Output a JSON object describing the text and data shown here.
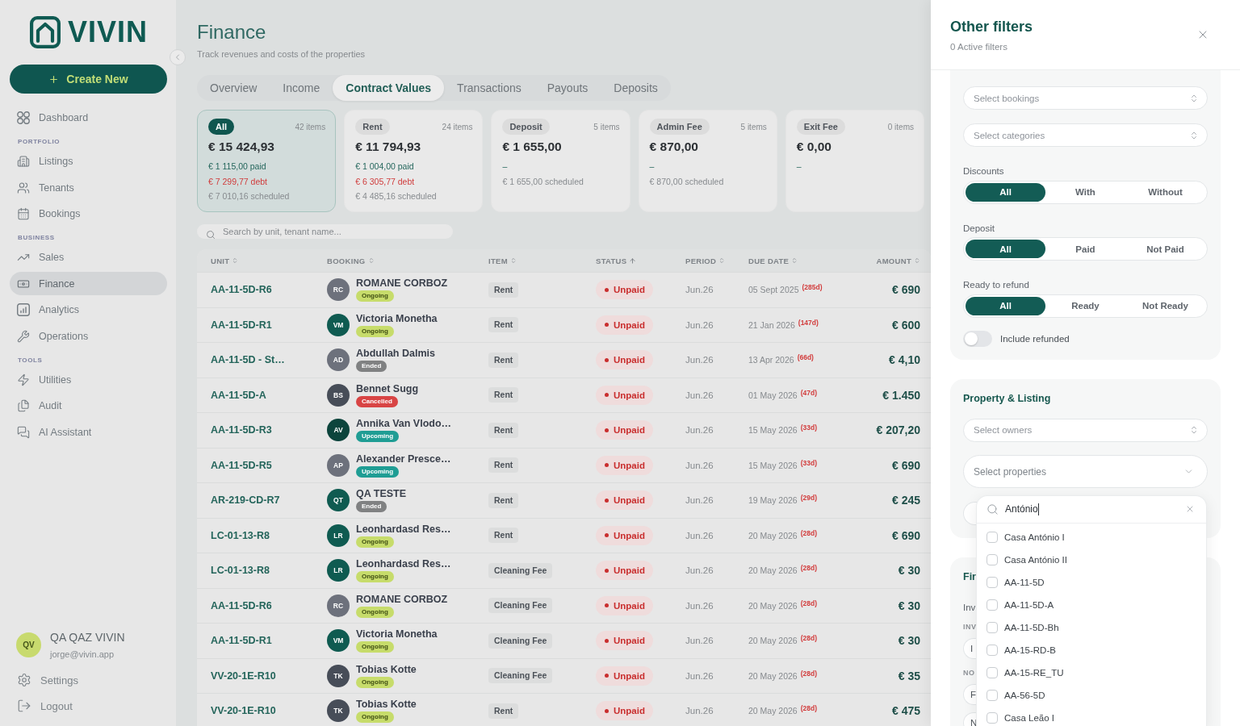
{
  "sidebar": {
    "logo": "VIVIN",
    "create_button": "Create New",
    "nav": [
      {
        "items": [
          {
            "label": "Dashboard",
            "selected": false
          }
        ]
      },
      {
        "heading": "PORTFOLIO",
        "items": [
          {
            "label": "Listings",
            "selected": false
          },
          {
            "label": "Tenants",
            "selected": false
          },
          {
            "label": "Bookings",
            "selected": false
          }
        ]
      },
      {
        "heading": "BUSINESS",
        "items": [
          {
            "label": "Sales",
            "selected": false
          },
          {
            "label": "Finance",
            "selected": true
          },
          {
            "label": "Analytics",
            "selected": false
          },
          {
            "label": "Operations",
            "selected": false
          }
        ]
      },
      {
        "heading": "TOOLS",
        "items": [
          {
            "label": "Utilities",
            "selected": false
          },
          {
            "label": "Audit",
            "selected": false
          },
          {
            "label": "AI Assistant",
            "selected": false
          }
        ]
      }
    ],
    "user": {
      "initials": "QV",
      "name": "QA QAZ VIVIN",
      "email": "jorge@vivin.app"
    },
    "footer_links": [
      "Settings",
      "Logout"
    ]
  },
  "page": {
    "title": "Finance",
    "subtitle": "Track revenues and costs of the properties"
  },
  "tabs": [
    {
      "label": "Overview",
      "selected": false
    },
    {
      "label": "Income",
      "selected": false
    },
    {
      "label": "Contract Values",
      "selected": true
    },
    {
      "label": "Transactions",
      "selected": false
    },
    {
      "label": "Payouts",
      "selected": false
    },
    {
      "label": "Deposits",
      "selected": false
    }
  ],
  "summary_cards": [
    {
      "label": "All",
      "count": "42 items",
      "total": "€ 15 424,93",
      "selected": true,
      "lines": [
        {
          "text": "€ 1 115,00 paid",
          "kind": "paid"
        },
        {
          "text": "€ 7 299,77 debt",
          "kind": "debt"
        },
        {
          "text": "€ 7 010,16 scheduled",
          "kind": "scheduled"
        }
      ]
    },
    {
      "label": "Rent",
      "count": "24 items",
      "total": "€ 11 794,93",
      "selected": false,
      "lines": [
        {
          "text": "€ 1 004,00 paid",
          "kind": "paid"
        },
        {
          "text": "€ 6 305,77 debt",
          "kind": "debt"
        },
        {
          "text": "€ 4 485,16 scheduled",
          "kind": "scheduled"
        }
      ]
    },
    {
      "label": "Deposit",
      "count": "5 items",
      "total": "€ 1 655,00",
      "selected": false,
      "lines": [
        {
          "text": "–",
          "kind": "paid"
        },
        {
          "text": "€ 1 655,00 scheduled",
          "kind": "scheduled"
        }
      ]
    },
    {
      "label": "Admin Fee",
      "count": "5 items",
      "total": "€ 870,00",
      "selected": false,
      "lines": [
        {
          "text": "–",
          "kind": "paid"
        },
        {
          "text": "€ 870,00 scheduled",
          "kind": "scheduled"
        }
      ]
    },
    {
      "label": "Exit Fee",
      "count": "0 items",
      "total": "€ 0,00",
      "selected": false,
      "lines": [
        {
          "text": "–",
          "kind": "paid"
        }
      ]
    }
  ],
  "search": {
    "placeholder": "Search by unit, tenant name..."
  },
  "table": {
    "columns": [
      {
        "label": "UNIT",
        "sorted": false
      },
      {
        "label": "BOOKING",
        "sorted": false
      },
      {
        "label": "ITEM",
        "sorted": false
      },
      {
        "label": "STATUS",
        "sorted": true
      },
      {
        "label": "PERIOD",
        "sorted": false
      },
      {
        "label": "DUE DATE",
        "sorted": false
      },
      {
        "label": "AMOUNT",
        "sorted": false
      }
    ],
    "rows": [
      {
        "unit": "AA-11-5D-R6",
        "booking": {
          "initials": "RC",
          "name": "ROMANE CORBOZ",
          "color": "#6d717c",
          "stage": {
            "label": "Ongoing",
            "kind": "ongoing"
          }
        },
        "item": "Rent",
        "status": {
          "label": "Unpaid",
          "kind": "unpaid"
        },
        "period": "Jun.26",
        "due_date": "05 Sept 2025",
        "overdue": "(285d)",
        "amount": "€ 690"
      },
      {
        "unit": "AA-11-5D-R1",
        "booking": {
          "initials": "VM",
          "name": "Victoria Monetha",
          "color": "#0f5b51",
          "stage": {
            "label": "Ongoing",
            "kind": "ongoing"
          }
        },
        "item": "Rent",
        "status": {
          "label": "Unpaid",
          "kind": "unpaid"
        },
        "period": "Jun.26",
        "due_date": "21 Jan 2026",
        "overdue": "(147d)",
        "amount": "€ 600"
      },
      {
        "unit": "AA-11-5D - St…",
        "booking": {
          "initials": "AD",
          "name": "Abdullah Dalmis",
          "color": "#6d717c",
          "stage": {
            "label": "Ended",
            "kind": "ended"
          }
        },
        "item": "Rent",
        "status": {
          "label": "Unpaid",
          "kind": "unpaid"
        },
        "period": "Jun.26",
        "due_date": "13 Apr 2026",
        "overdue": "(66d)",
        "amount": "€ 4,10"
      },
      {
        "unit": "AA-11-5D-A",
        "booking": {
          "initials": "BS",
          "name": "Bennet Sugg",
          "color": "#474d58",
          "stage": {
            "label": "Cancelled",
            "kind": "cancelled"
          }
        },
        "item": "Rent",
        "status": {
          "label": "Unpaid",
          "kind": "unpaid"
        },
        "period": "Jun.26",
        "due_date": "01 May 2026",
        "overdue": "(47d)",
        "amount": "€ 1.450"
      },
      {
        "unit": "AA-11-5D-R3",
        "booking": {
          "initials": "AV",
          "name": "Annika Van Vlodo…",
          "color": "#0c443c",
          "stage": {
            "label": "Upcoming",
            "kind": "upcoming"
          }
        },
        "item": "Rent",
        "status": {
          "label": "Unpaid",
          "kind": "unpaid"
        },
        "period": "Jun.26",
        "due_date": "15 May 2026",
        "overdue": "(33d)",
        "amount": "€ 207,20"
      },
      {
        "unit": "AA-11-5D-R5",
        "booking": {
          "initials": "AP",
          "name": "Alexander Presce…",
          "color": "#6d717c",
          "stage": {
            "label": "Upcoming",
            "kind": "upcoming"
          }
        },
        "item": "Rent",
        "status": {
          "label": "Unpaid",
          "kind": "unpaid"
        },
        "period": "Jun.26",
        "due_date": "15 May 2026",
        "overdue": "(33d)",
        "amount": "€ 690"
      },
      {
        "unit": "AR-219-CD-R7",
        "booking": {
          "initials": "QT",
          "name": "QA TESTE",
          "color": "#0f5b51",
          "stage": {
            "label": "Ended",
            "kind": "ended"
          }
        },
        "item": "Rent",
        "status": {
          "label": "Unpaid",
          "kind": "unpaid"
        },
        "period": "Jun.26",
        "due_date": "19 May 2026",
        "overdue": "(29d)",
        "amount": "€ 245"
      },
      {
        "unit": "LC-01-13-R8",
        "booking": {
          "initials": "LR",
          "name": "Leonhardasd Res…",
          "color": "#0f5b51",
          "stage": {
            "label": "Ongoing",
            "kind": "ongoing"
          }
        },
        "item": "Rent",
        "status": {
          "label": "Unpaid",
          "kind": "unpaid"
        },
        "period": "Jun.26",
        "due_date": "20 May 2026",
        "overdue": "(28d)",
        "amount": "€ 690"
      },
      {
        "unit": "LC-01-13-R8",
        "booking": {
          "initials": "LR",
          "name": "Leonhardasd Res…",
          "color": "#0f5b51",
          "stage": {
            "label": "Ongoing",
            "kind": "ongoing"
          }
        },
        "item": "Cleaning Fee",
        "status": {
          "label": "Unpaid",
          "kind": "unpaid"
        },
        "period": "Jun.26",
        "due_date": "20 May 2026",
        "overdue": "(28d)",
        "amount": "€ 30"
      },
      {
        "unit": "AA-11-5D-R6",
        "booking": {
          "initials": "RC",
          "name": "ROMANE CORBOZ",
          "color": "#6d717c",
          "stage": {
            "label": "Ongoing",
            "kind": "ongoing"
          }
        },
        "item": "Cleaning Fee",
        "status": {
          "label": "Unpaid",
          "kind": "unpaid"
        },
        "period": "Jun.26",
        "due_date": "20 May 2026",
        "overdue": "(28d)",
        "amount": "€ 30"
      },
      {
        "unit": "AA-11-5D-R1",
        "booking": {
          "initials": "VM",
          "name": "Victoria Monetha",
          "color": "#0f5b51",
          "stage": {
            "label": "Ongoing",
            "kind": "ongoing"
          }
        },
        "item": "Cleaning Fee",
        "status": {
          "label": "Unpaid",
          "kind": "unpaid"
        },
        "period": "Jun.26",
        "due_date": "20 May 2026",
        "overdue": "(28d)",
        "amount": "€ 30"
      },
      {
        "unit": "VV-20-1E-R10",
        "booking": {
          "initials": "TK",
          "name": "Tobias Kotte",
          "color": "#474d58",
          "stage": {
            "label": "Ongoing",
            "kind": "ongoing"
          }
        },
        "item": "Cleaning Fee",
        "status": {
          "label": "Unpaid",
          "kind": "unpaid"
        },
        "period": "Jun.26",
        "due_date": "20 May 2026",
        "overdue": "(28d)",
        "amount": "€ 35"
      },
      {
        "unit": "VV-20-1E-R10",
        "booking": {
          "initials": "TK",
          "name": "Tobias Kotte",
          "color": "#474d58",
          "stage": {
            "label": "Ongoing",
            "kind": "ongoing"
          }
        },
        "item": "Rent",
        "status": {
          "label": "Unpaid",
          "kind": "unpaid"
        },
        "period": "Jun.26",
        "due_date": "20 May 2026",
        "overdue": "(28d)",
        "amount": "€ 475"
      }
    ]
  },
  "filters_panel": {
    "title": "Other filters",
    "subtitle": "0 Active filters",
    "booking_section": {
      "selects": [
        {
          "placeholder": "Select bookings"
        },
        {
          "placeholder": "Select categories"
        }
      ],
      "segments": [
        {
          "label": "Discounts",
          "options": [
            {
              "label": "All",
              "selected": true
            },
            {
              "label": "With",
              "selected": false
            },
            {
              "label": "Without",
              "selected": false
            }
          ]
        },
        {
          "label": "Deposit",
          "options": [
            {
              "label": "All",
              "selected": true
            },
            {
              "label": "Paid",
              "selected": false
            },
            {
              "label": "Not Paid",
              "selected": false
            }
          ]
        },
        {
          "label": "Ready to refund",
          "options": [
            {
              "label": "All",
              "selected": true
            },
            {
              "label": "Ready",
              "selected": false
            },
            {
              "label": "Not Ready",
              "selected": false
            }
          ]
        }
      ],
      "switch": {
        "label": "Include refunded",
        "on": false
      }
    },
    "property_section": {
      "title": "Property & Listing",
      "selects": [
        {
          "placeholder": "Select owners",
          "expanded": false,
          "covered": false
        },
        {
          "placeholder": "Select properties",
          "expanded": true,
          "covered": false
        },
        {
          "expanded": false,
          "covered": true
        }
      ],
      "dropdown": {
        "search_value": "António",
        "focused": true,
        "options": [
          {
            "label": "Casa António I",
            "checked": false
          },
          {
            "label": "Casa António II",
            "checked": false
          },
          {
            "label": "AA-11-5D",
            "checked": false
          },
          {
            "label": "AA-11-5D-A",
            "checked": false
          },
          {
            "label": "AA-11-5D-Bh",
            "checked": false
          },
          {
            "label": "AA-15-RD-B",
            "checked": false
          },
          {
            "label": "AA-15-RE_TU",
            "checked": false
          },
          {
            "label": "AA-56-5D",
            "checked": false
          },
          {
            "label": "Casa Leão I",
            "checked": false
          }
        ]
      }
    },
    "finance_section": {
      "title": "Fir",
      "items": [
        {
          "kind": "label",
          "text": "Inv"
        },
        {
          "kind": "caption",
          "text": "INV"
        },
        {
          "kind": "field",
          "text": "I",
          "covered": true
        },
        {
          "kind": "caption",
          "text": "NO"
        },
        {
          "kind": "field",
          "text": "F",
          "covered": true
        },
        {
          "kind": "field",
          "text": "N",
          "covered": true
        }
      ]
    }
  }
}
